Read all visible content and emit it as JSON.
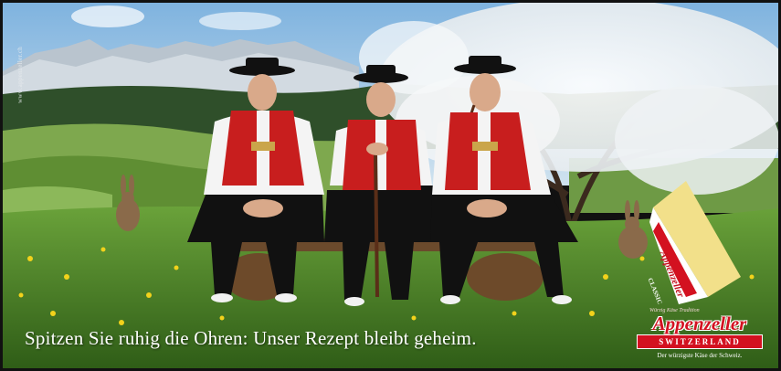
{
  "ad": {
    "side_url": "www.appenzeller.ch",
    "slogan": "Spitzen Sie ruhig die Ohren: Unser Rezept bleibt geheim.",
    "brand": {
      "top_line": "Würzig  Käse  Tradition",
      "name": "Appenzeller",
      "country": "SWITZERLAND",
      "tagline": "Der würzigste Käse der Schweiz."
    },
    "package": {
      "label": "Appenzeller",
      "variant": "CLASSIC"
    }
  },
  "colors": {
    "sky": "#9fc6e6",
    "meadow": "#4f8a2a",
    "vest_red": "#c81e1e",
    "brand_red": "#d31120"
  }
}
